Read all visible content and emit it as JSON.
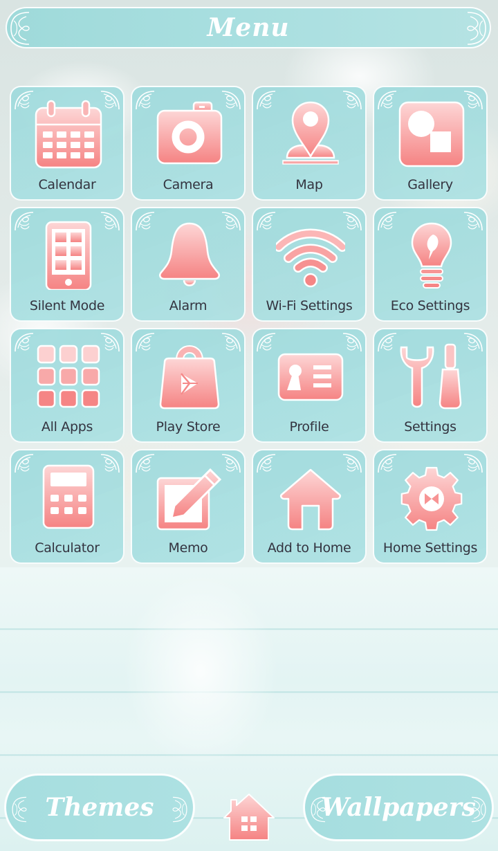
{
  "header": {
    "title": "Menu"
  },
  "colors": {
    "tile_bg": "#a3dcdd",
    "icon_pink_top": "#fcd3d3",
    "icon_pink_bottom": "#f58585",
    "label_text": "#33333f",
    "white": "#ffffff"
  },
  "tiles": [
    {
      "label": "Calendar",
      "icon": "calendar-icon"
    },
    {
      "label": "Camera",
      "icon": "camera-icon"
    },
    {
      "label": "Map",
      "icon": "map-pin-icon"
    },
    {
      "label": "Gallery",
      "icon": "gallery-icon"
    },
    {
      "label": "Silent Mode",
      "icon": "phone-icon"
    },
    {
      "label": "Alarm",
      "icon": "bell-icon"
    },
    {
      "label": "Wi-Fi Settings",
      "icon": "wifi-icon"
    },
    {
      "label": "Eco Settings",
      "icon": "lightbulb-leaf-icon"
    },
    {
      "label": "All Apps",
      "icon": "app-grid-icon"
    },
    {
      "label": "Play Store",
      "icon": "shopping-bag-play-icon"
    },
    {
      "label": "Profile",
      "icon": "id-card-icon"
    },
    {
      "label": "Settings",
      "icon": "wrench-screwdriver-icon"
    },
    {
      "label": "Calculator",
      "icon": "calculator-icon"
    },
    {
      "label": "Memo",
      "icon": "memo-pencil-icon"
    },
    {
      "label": "Add to Home",
      "icon": "house-icon"
    },
    {
      "label": "Home Settings",
      "icon": "gear-ribbon-icon"
    }
  ],
  "bottom": {
    "themes_label": "Themes",
    "wallpapers_label": "Wallpapers",
    "home_icon": "home-icon"
  }
}
